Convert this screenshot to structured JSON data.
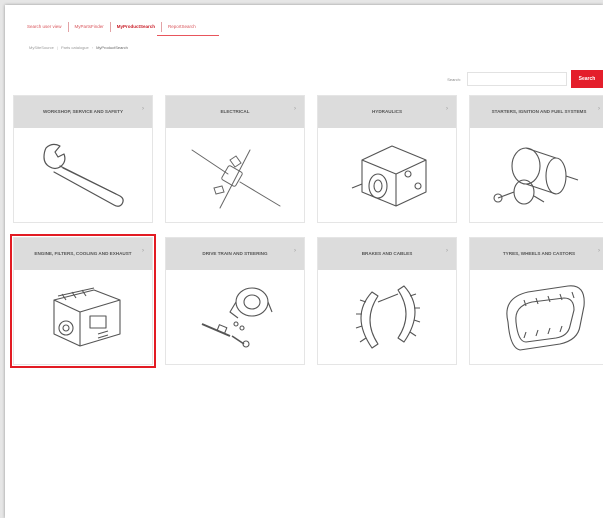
{
  "nav": {
    "items": [
      {
        "label": "Search user view",
        "active": false
      },
      {
        "label": "MyPartsFinder",
        "active": false
      },
      {
        "label": "MyProductSearch",
        "active": true
      },
      {
        "label": "ReportSearch",
        "active": false
      }
    ]
  },
  "breadcrumb": {
    "items": [
      "MySiteSource",
      "Parts catalogue",
      "MyProductSearch"
    ]
  },
  "search": {
    "label": "Search:",
    "value": "",
    "button": "Search"
  },
  "categories": [
    {
      "title": "WORKSHOP, SERVICE AND SAFETY",
      "icon": "wrench-icon",
      "selected": false
    },
    {
      "title": "ELECTRICAL",
      "icon": "electrical-connector-icon",
      "selected": false
    },
    {
      "title": "HYDRAULICS",
      "icon": "hydraulic-pump-icon",
      "selected": false
    },
    {
      "title": "STARTERS, IGNITION AND FUEL SYSTEMS",
      "icon": "starter-motor-icon",
      "selected": false
    },
    {
      "title": "ENGINE, FILTERS, COOLING AND EXHAUST",
      "icon": "engine-icon",
      "selected": true
    },
    {
      "title": "DRIVE TRAIN AND STEERING",
      "icon": "drivetrain-icon",
      "selected": false
    },
    {
      "title": "BRAKES AND CABLES",
      "icon": "brake-shoe-icon",
      "selected": false
    },
    {
      "title": "TYRES, WHEELS AND CASTORS",
      "icon": "track-wheel-icon",
      "selected": false
    }
  ],
  "colors": {
    "accent": "#e41e2b",
    "selected_outline": "#e21b23",
    "card_header": "#dcdcdc"
  }
}
